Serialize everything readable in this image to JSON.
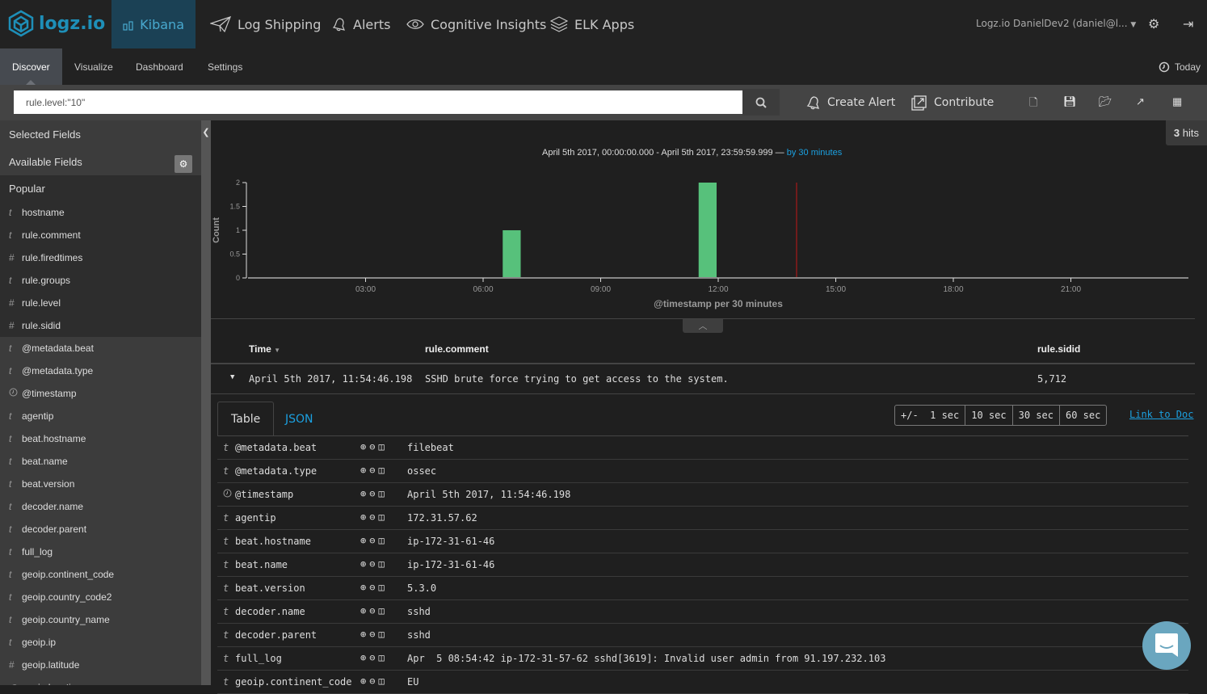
{
  "topnav": {
    "logo": "logz.io",
    "items": [
      {
        "label": "Kibana",
        "icon": "bar-chart-icon",
        "active": true
      },
      {
        "label": "Log Shipping",
        "icon": "paper-plane-icon"
      },
      {
        "label": "Alerts",
        "icon": "bell-icon"
      },
      {
        "label": "Cognitive Insights",
        "icon": "eye-icon"
      },
      {
        "label": "ELK Apps",
        "icon": "layers-icon"
      }
    ],
    "user": "Logz.io DanielDev2 (daniel@l...",
    "settings_icon": "gear-icon",
    "logout_icon": "logout-icon"
  },
  "subnav": {
    "tabs": [
      "Discover",
      "Visualize",
      "Dashboard",
      "Settings"
    ],
    "active": "Discover",
    "time_label": "Today"
  },
  "querybar": {
    "query": "rule.level:\"10\"",
    "create_alert": "Create Alert",
    "contribute": "Contribute",
    "icons": [
      "new-search-icon",
      "save-icon",
      "open-icon",
      "share-icon",
      "table-icon"
    ]
  },
  "sidebar": {
    "selected_fields": "Selected Fields",
    "available_fields": "Available Fields",
    "popular": "Popular",
    "popular_fields": [
      {
        "type": "t",
        "name": "hostname"
      },
      {
        "type": "t",
        "name": "rule.comment"
      },
      {
        "type": "#",
        "name": "rule.firedtimes"
      },
      {
        "type": "t",
        "name": "rule.groups"
      },
      {
        "type": "#",
        "name": "rule.level"
      },
      {
        "type": "#",
        "name": "rule.sidid"
      }
    ],
    "fields": [
      {
        "type": "t",
        "name": "@metadata.beat"
      },
      {
        "type": "t",
        "name": "@metadata.type"
      },
      {
        "type": "clock",
        "name": "@timestamp"
      },
      {
        "type": "t",
        "name": "agentip"
      },
      {
        "type": "t",
        "name": "beat.hostname"
      },
      {
        "type": "t",
        "name": "beat.name"
      },
      {
        "type": "t",
        "name": "beat.version"
      },
      {
        "type": "t",
        "name": "decoder.name"
      },
      {
        "type": "t",
        "name": "decoder.parent"
      },
      {
        "type": "t",
        "name": "full_log"
      },
      {
        "type": "t",
        "name": "geoip.continent_code"
      },
      {
        "type": "t",
        "name": "geoip.country_code2"
      },
      {
        "type": "t",
        "name": "geoip.country_name"
      },
      {
        "type": "t",
        "name": "geoip.ip"
      },
      {
        "type": "#",
        "name": "geoip.latitude"
      },
      {
        "type": "geo",
        "name": "geoip.location"
      }
    ]
  },
  "main": {
    "hits_count": "3",
    "hits_label": "hits",
    "range_text": "April 5th 2017, 00:00:00.000 - April 5th 2017, 23:59:59.999 —",
    "interval_link": "by 30 minutes",
    "columns": [
      "Time",
      "rule.comment",
      "rule.sidid"
    ],
    "doc": {
      "time": "April 5th 2017, 11:54:46.198",
      "comment": "SSHD brute force trying to get access to the system.",
      "sidid": "5,712"
    },
    "detail_tabs": [
      "Table",
      "JSON"
    ],
    "sec_buttons": [
      "+/-  1 sec",
      "10 sec",
      "30 sec",
      "60 sec"
    ],
    "link_to_doc": "Link to Doc",
    "detail_fields": [
      {
        "type": "t",
        "name": "@metadata.beat",
        "value": "filebeat"
      },
      {
        "type": "clock-none",
        "name": "@metadata.type",
        "value": "ossec"
      },
      {
        "type": "clock",
        "name": "@timestamp",
        "value": "April 5th 2017, 11:54:46.198"
      },
      {
        "type": "t",
        "name": "agentip",
        "value": "172.31.57.62"
      },
      {
        "type": "t",
        "name": "beat.hostname",
        "value": "ip-172-31-61-46"
      },
      {
        "type": "t",
        "name": "beat.name",
        "value": "ip-172-31-61-46"
      },
      {
        "type": "t",
        "name": "beat.version",
        "value": "5.3.0"
      },
      {
        "type": "t",
        "name": "decoder.name",
        "value": "sshd"
      },
      {
        "type": "t",
        "name": "decoder.parent",
        "value": "sshd"
      },
      {
        "type": "t",
        "name": "full_log",
        "value": "Apr  5 08:54:42 ip-172-31-57-62 sshd[3619]: Invalid user admin from 91.197.232.103"
      },
      {
        "type": "t",
        "name": "geoip.continent_code",
        "value": "EU"
      }
    ]
  },
  "chart_data": {
    "type": "bar",
    "title": "",
    "xlabel": "@timestamp per 30 minutes",
    "ylabel": "Count",
    "x_range_hours": [
      0,
      24
    ],
    "ylim": [
      0,
      2
    ],
    "yticks": [
      0,
      0.5,
      1,
      1.5,
      2
    ],
    "xticks": [
      "03:00",
      "06:00",
      "09:00",
      "12:00",
      "15:00",
      "18:00",
      "21:00"
    ],
    "bin_minutes": 30,
    "bars": [
      {
        "start": "06:30",
        "value": 1
      },
      {
        "start": "11:30",
        "value": 2
      }
    ],
    "current_time_marker": "14:00",
    "bar_color": "#57c17b",
    "marker_color": "#8b1a1a"
  }
}
